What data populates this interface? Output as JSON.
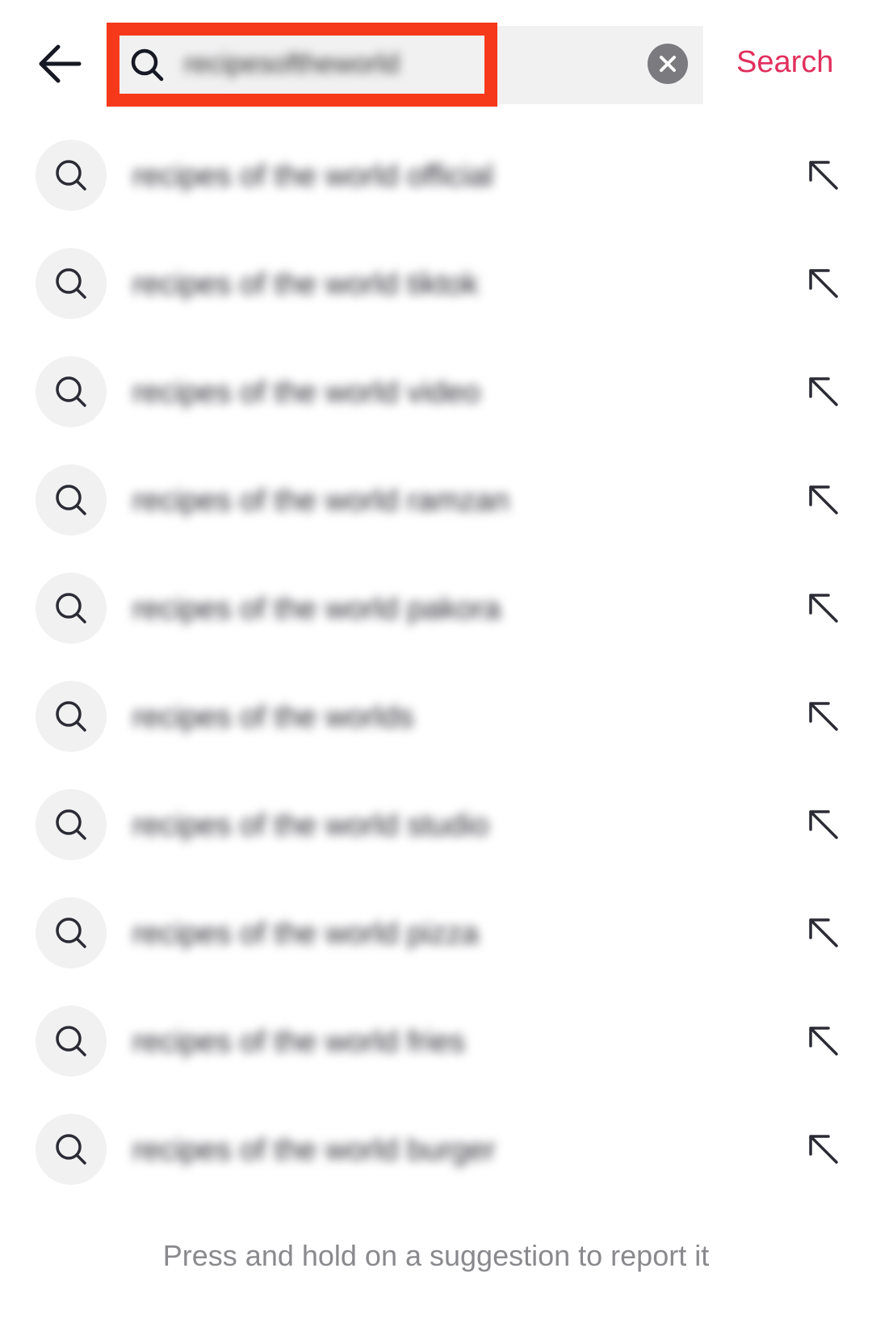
{
  "header": {
    "back_icon": "arrow-left-icon",
    "search_icon": "magnifier-icon",
    "query": "recipesoftheworld",
    "clear_icon": "close-circle-icon",
    "search_label": "Search",
    "accent": "#e1305d",
    "highlight_color": "#f5391a"
  },
  "suggestions": [
    {
      "text": "recipes of the world official"
    },
    {
      "text": "recipes of the world tiktok"
    },
    {
      "text": "recipes of the world video"
    },
    {
      "text": "recipes of the world ramzan"
    },
    {
      "text": "recipes of the world pakora"
    },
    {
      "text": "recipes of the worlds"
    },
    {
      "text": "recipes of the world studio"
    },
    {
      "text": "recipes of the world pizza"
    },
    {
      "text": "recipes of the world fries"
    },
    {
      "text": "recipes of the world burger"
    }
  ],
  "footer": {
    "hint": "Press and hold on a suggestion to report it"
  }
}
